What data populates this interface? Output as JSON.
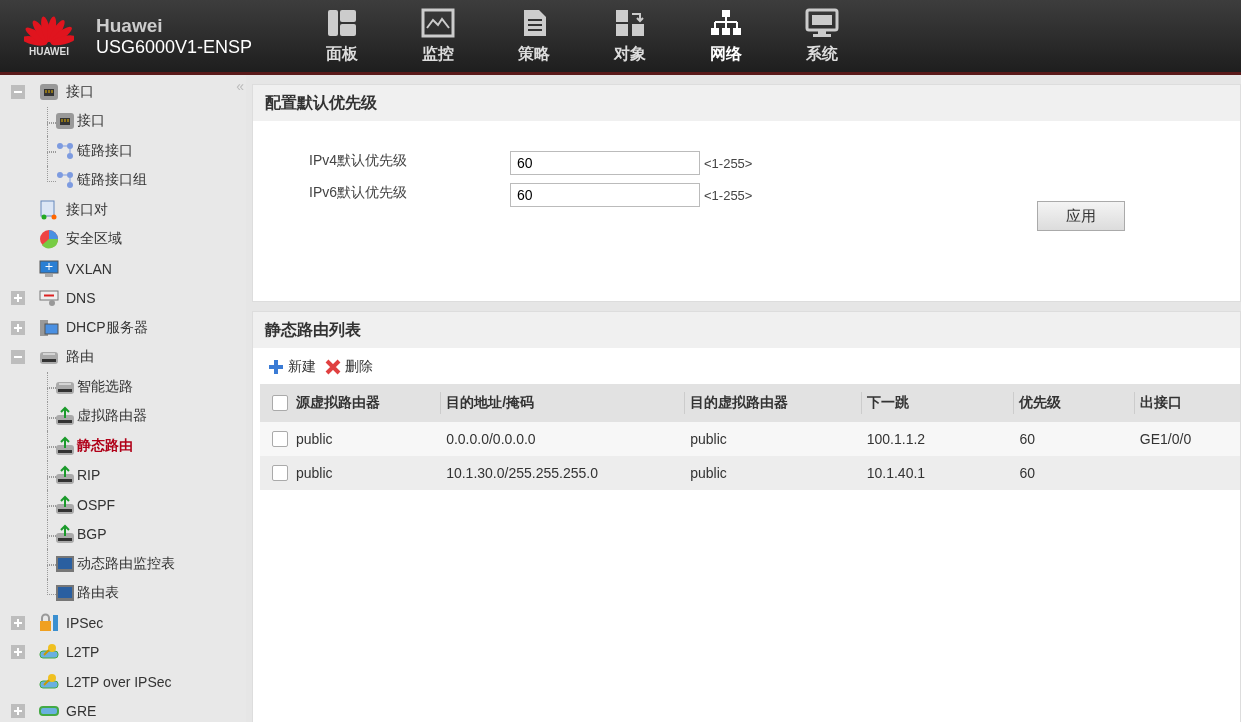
{
  "header": {
    "brand": "HUAWEI",
    "product": "Huawei",
    "model": "USG6000V1-ENSP",
    "nav": [
      {
        "label": "面板",
        "selected": false
      },
      {
        "label": "监控",
        "selected": false
      },
      {
        "label": "策略",
        "selected": false
      },
      {
        "label": "对象",
        "selected": false
      },
      {
        "label": "网络",
        "selected": true
      },
      {
        "label": "系统",
        "selected": false
      }
    ]
  },
  "sidebar": {
    "collapse": "«",
    "items": [
      {
        "label": "接口",
        "kind": "folder",
        "expanded": true,
        "selected": false,
        "children": [
          {
            "label": "接口",
            "selected": false
          },
          {
            "label": "链路接口",
            "selected": false
          },
          {
            "label": "链路接口组",
            "selected": false
          }
        ]
      },
      {
        "label": "接口对",
        "kind": "leaf",
        "selected": false
      },
      {
        "label": "安全区域",
        "kind": "leaf",
        "selected": false
      },
      {
        "label": "VXLAN",
        "kind": "leaf",
        "selected": false
      },
      {
        "label": "DNS",
        "kind": "folder",
        "expanded": false,
        "selected": false
      },
      {
        "label": "DHCP服务器",
        "kind": "folder",
        "expanded": false,
        "selected": false
      },
      {
        "label": "路由",
        "kind": "folder",
        "expanded": true,
        "selected": false,
        "children": [
          {
            "label": "智能选路",
            "selected": false
          },
          {
            "label": "虚拟路由器",
            "selected": false
          },
          {
            "label": "静态路由",
            "selected": true
          },
          {
            "label": "RIP",
            "selected": false
          },
          {
            "label": "OSPF",
            "selected": false
          },
          {
            "label": "BGP",
            "selected": false
          },
          {
            "label": "动态路由监控表",
            "selected": false
          },
          {
            "label": "路由表",
            "selected": false
          }
        ]
      },
      {
        "label": "IPSec",
        "kind": "folder",
        "expanded": false,
        "selected": false
      },
      {
        "label": "L2TP",
        "kind": "folder",
        "expanded": false,
        "selected": false
      },
      {
        "label": "L2TP over IPSec",
        "kind": "leaf",
        "selected": false
      },
      {
        "label": "GRE",
        "kind": "folder",
        "expanded": false,
        "selected": false
      }
    ]
  },
  "priority_panel": {
    "title": "配置默认优先级",
    "fields": [
      {
        "label": "IPv4默认优先级",
        "value": "60",
        "hint": "<1-255>"
      },
      {
        "label": "IPv6默认优先级",
        "value": "60",
        "hint": "<1-255>"
      }
    ],
    "button": "应用"
  },
  "route_panel": {
    "title": "静态路由列表",
    "toolbar": [
      {
        "label": "新建",
        "kind": "add"
      },
      {
        "label": "删除",
        "kind": "delete"
      }
    ],
    "table": {
      "select_all_checked": false,
      "columns": [
        "源虚拟路由器",
        "目的地址/掩码",
        "目的虚拟路由器",
        "下一跳",
        "优先级",
        "出接口"
      ],
      "rows": [
        {
          "checked": false,
          "cells": [
            "public",
            "0.0.0.0/0.0.0.0",
            "public",
            "100.1.1.2",
            "60",
            "GE1/0/0"
          ]
        },
        {
          "checked": false,
          "cells": [
            "public",
            "10.1.30.0/255.255.255.0",
            "public",
            "10.1.40.1",
            "60",
            ""
          ]
        }
      ]
    }
  }
}
